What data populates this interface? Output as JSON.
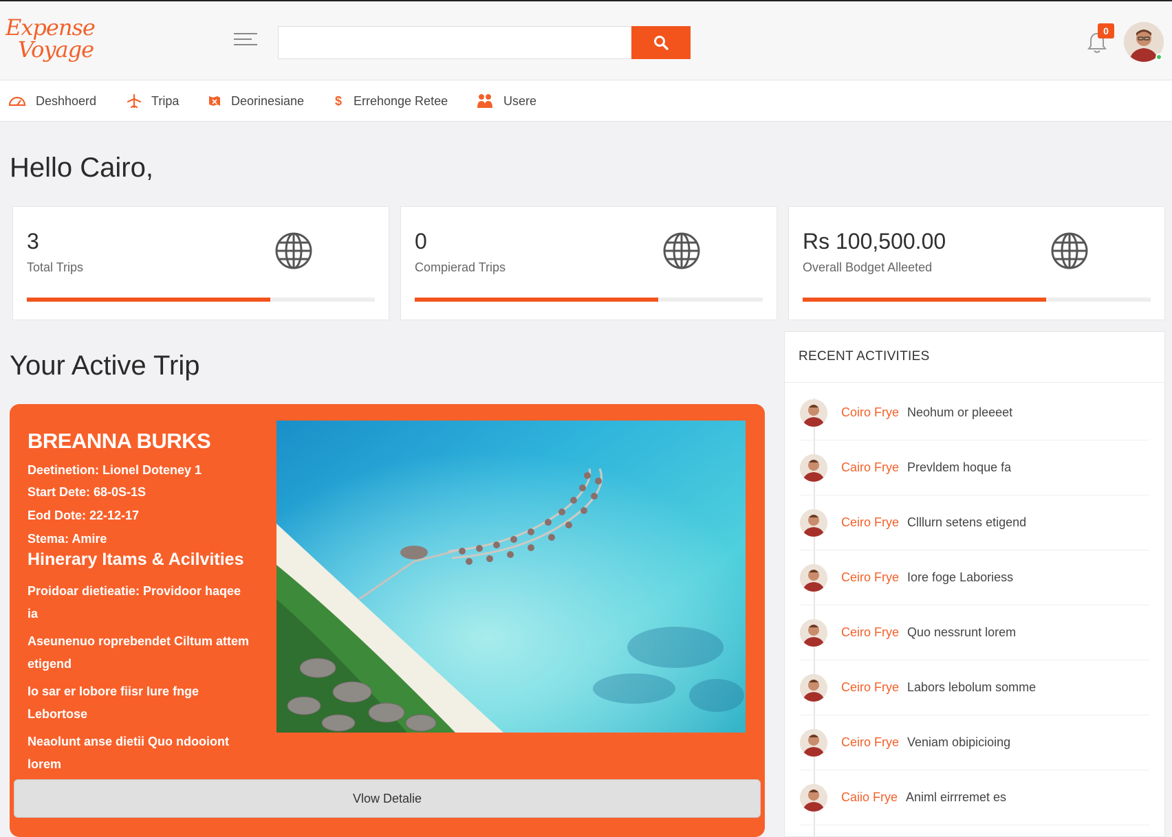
{
  "app": {
    "logo_line1": "Expense",
    "logo_line2": "Voyage"
  },
  "header": {
    "search_placeholder": "",
    "notification_count": "0"
  },
  "nav": {
    "items": [
      {
        "label": "Deshhoerd",
        "icon": "dashboard-icon"
      },
      {
        "label": "Tripa",
        "icon": "plane-icon"
      },
      {
        "label": "Deorinesiane",
        "icon": "destination-icon"
      },
      {
        "label": "Errehonge Retee",
        "icon": "dollar-icon"
      },
      {
        "label": "Usere",
        "icon": "users-icon"
      }
    ]
  },
  "greeting": "Hello Cairo,",
  "stats": [
    {
      "value": "3",
      "label": "Total Trips",
      "progress": 0.7
    },
    {
      "value": "0",
      "label": "Compierad Trips",
      "progress": 0.7
    },
    {
      "value": "Rs 100,500.00",
      "label": "Overall Bodget Alleeted",
      "progress": 0.7
    }
  ],
  "active_trip": {
    "section_title": "Your Active Trip",
    "name": "BREANNA BURKS",
    "destination": "Deetinetion: Lionel Doteney 1",
    "start_date": "Start Dete: 68-0S-1S",
    "end_date": "Eod Dote: 22-12-17",
    "status": "Stema: Amire",
    "itinerary_title": "Hinerary Itams & Acilvities",
    "itinerary": [
      "Proidoar dietieatie: Providoor haqee ia",
      "Aseunenuo roprebendet Ciltum attem etigend",
      "Io sar er Iobore fiisr Iure fnge Lebortose",
      "Neaolunt anse dietii Quo ndooiont lorem"
    ],
    "view_button": "Vlow Detalie"
  },
  "recent_activities": {
    "title": "RECENT ACTIVITIES",
    "items": [
      {
        "user": "Coiro Frye",
        "text": "Neohum or pleeeet"
      },
      {
        "user": "Cairo Frye",
        "text": "Prevldem hoque fa"
      },
      {
        "user": "Ceiro Frye",
        "text": "Clllurn setens etigend"
      },
      {
        "user": "Ceiro Frye",
        "text": "Iore foge Laboriess"
      },
      {
        "user": "Ceiro Frye",
        "text": "Quo nessrunt lorem"
      },
      {
        "user": "Ceiro Frye",
        "text": "Labors lebolum somme"
      },
      {
        "user": "Ceiro Frye",
        "text": "Veniam obipicioing"
      },
      {
        "user": "Caiio Frye",
        "text": "Animl eirrremet es"
      }
    ]
  },
  "colors": {
    "accent": "#f2541c",
    "card_orange": "#f8602a"
  }
}
